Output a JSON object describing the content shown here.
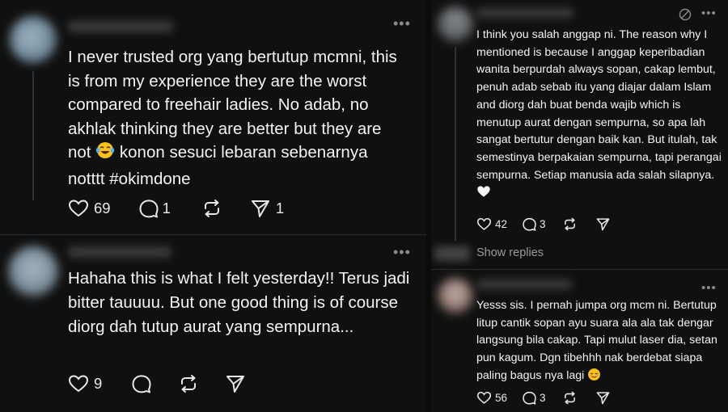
{
  "left": {
    "post1": {
      "text": "I never trusted org yang bertutup mcmni, this is from my experience they are the worst compared to freehair ladies. No adab, no akhlak thinking they are better but they are not",
      "text_end": "konon sesuci lebaran sebenarnya notttt #okimdone",
      "emoji": "laughing-tears",
      "likes": "69",
      "replies": "1",
      "shares": "1"
    },
    "post2": {
      "text": "Hahaha this is what I felt yesterday!! Terus jadi bitter tauuuu. But one good thing is of course diorg dah tutup aurat yang sempurna...",
      "likes": "9"
    }
  },
  "right": {
    "post1": {
      "text": "I think you salah anggap ni. The reason why I mentioned is because I anggap keperibadian wanita berpurdah always sopan, cakap lembut, penuh adab sebab itu yang diajar dalam Islam and diorg dah buat benda wajib which is menutup aurat dengan sempurna, so apa lah sangat bertutur dengan baik kan. But itulah, tak semestinya berpakaian sempurna, tapi perangai sempurna. Setiap manusia ada salah silapnya.",
      "emoji": "white-heart",
      "likes": "42",
      "replies": "3"
    },
    "show_replies": "Show replies",
    "post2": {
      "text": "Yesss sis. I pernah jumpa org mcm ni. Bertutup litup cantik sopan ayu suara ala ala tak dengar langsung bila cakap. Tapi mulut laser dia, setan pun kagum. Dgn tibehhh nak berdebat siapa paling bagus nya lagi",
      "emoji": "relieved-face",
      "likes": "56",
      "replies": "3"
    }
  },
  "icons": {
    "like": "heart-icon",
    "reply": "comment-icon",
    "repost": "repost-icon",
    "share": "send-icon",
    "more": "more-icon",
    "muted": "muted-icon"
  },
  "colors": {
    "background": "#101010",
    "text": "#f3f3f3",
    "muted_text": "#9a9a9a",
    "divider": "#2c2c2c"
  }
}
